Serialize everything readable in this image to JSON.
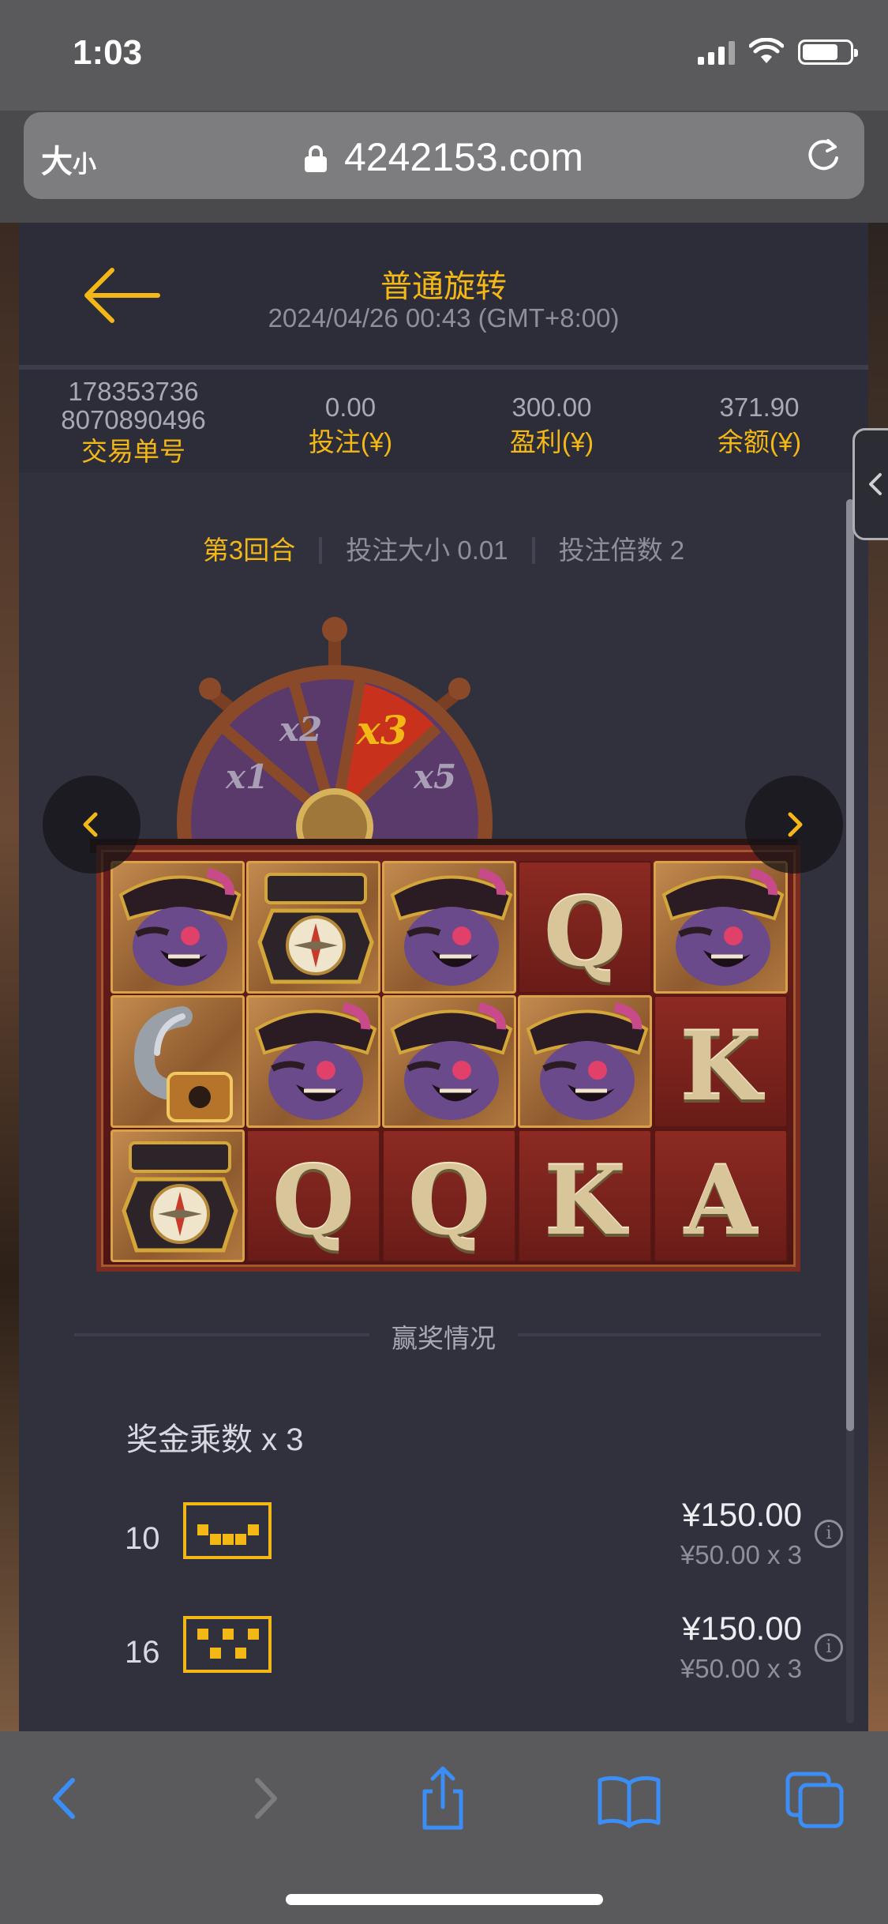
{
  "status_bar": {
    "time": "1:03"
  },
  "browser": {
    "text_size_big": "大",
    "text_size_small": "小",
    "url": "4242153.com"
  },
  "record": {
    "title": "普通旋转",
    "datetime": "2024/04/26 00:43 (GMT+8:00)",
    "transaction_id_line1": "178353736",
    "transaction_id_line2": "8070890496",
    "transaction_label": "交易单号",
    "bet_value": "0.00",
    "bet_label": "投注(¥)",
    "profit_value": "300.00",
    "profit_label": "盈利(¥)",
    "balance_value": "371.90",
    "balance_label": "余额(¥)"
  },
  "round": {
    "round_label": "第3回合",
    "bet_size": "投注大小 0.01",
    "bet_multiplier": "投注倍数 2"
  },
  "wheel": {
    "segments": [
      "x1",
      "x2",
      "x3",
      "x5"
    ],
    "active": "x3"
  },
  "reels": [
    [
      "pirate",
      "compass",
      "pirate",
      "Q",
      "pirate"
    ],
    [
      "hook",
      "pirate",
      "pirate",
      "pirate",
      "K"
    ],
    [
      "compass",
      "Q",
      "Q",
      "K",
      "A"
    ]
  ],
  "win": {
    "section_title": "赢奖情况",
    "multiplier": "奖金乘数 x 3",
    "lines": [
      {
        "line": "10",
        "amount": "¥150.00",
        "formula": "¥50.00 x 3"
      },
      {
        "line": "16",
        "amount": "¥150.00",
        "formula": "¥50.00 x 3"
      }
    ]
  },
  "colors": {
    "accent": "#f3b716",
    "panel": "#30313c",
    "ios_blue": "#3a8ef6"
  }
}
